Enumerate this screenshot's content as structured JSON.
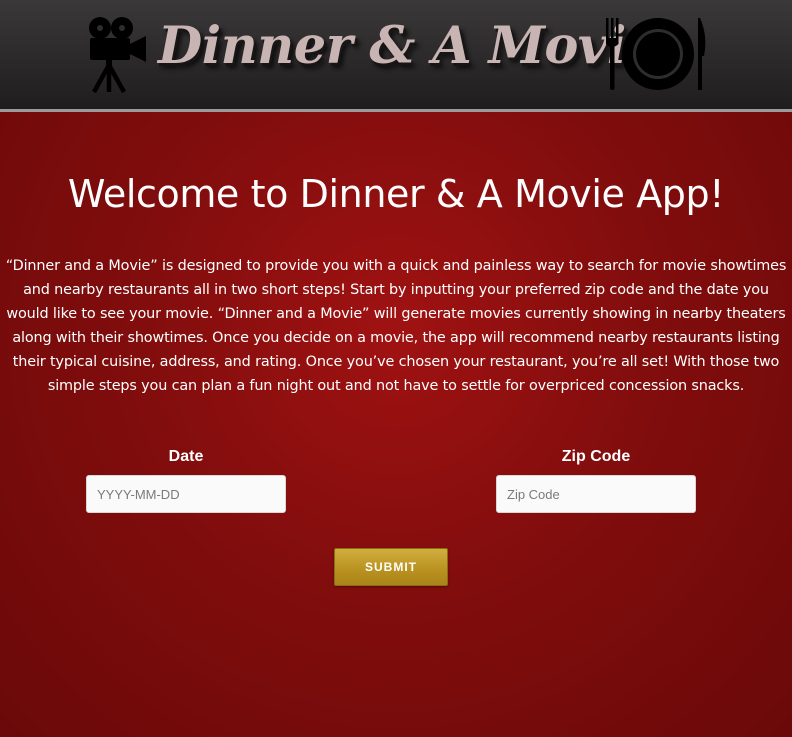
{
  "header": {
    "logo_text": "Dinner & A Movie",
    "camera_icon": "movie-camera-icon",
    "dining_icon": "fork-plate-knife-icon"
  },
  "main": {
    "title": "Welcome to Dinner & A Movie App!",
    "description": "“Dinner and a Movie” is designed to provide you with a quick and painless way to search for movie showtimes and nearby restaurants all in two short steps! Start by inputting your preferred zip code and the date you would like to see your movie. “Dinner and a Movie” will generate movies currently showing in nearby theaters along with their showtimes. Once you decide on a movie, the app will recommend nearby restaurants listing their typical cuisine, address, and rating. Once you’ve chosen your restaurant, you’re all set! With those two simple steps you can plan a fun night out and not have to settle for overpriced concession snacks."
  },
  "form": {
    "date_label": "Date",
    "date_value": "",
    "date_placeholder": "YYYY-MM-DD",
    "zip_label": "Zip Code",
    "zip_value": "",
    "zip_placeholder": "Zip Code",
    "submit_label": "SUBMIT"
  },
  "colors": {
    "background": "#8c0f0f",
    "header": "#2e2c2c",
    "logo_text": "#c9b4b4",
    "submit_button": "#c29c2c"
  }
}
